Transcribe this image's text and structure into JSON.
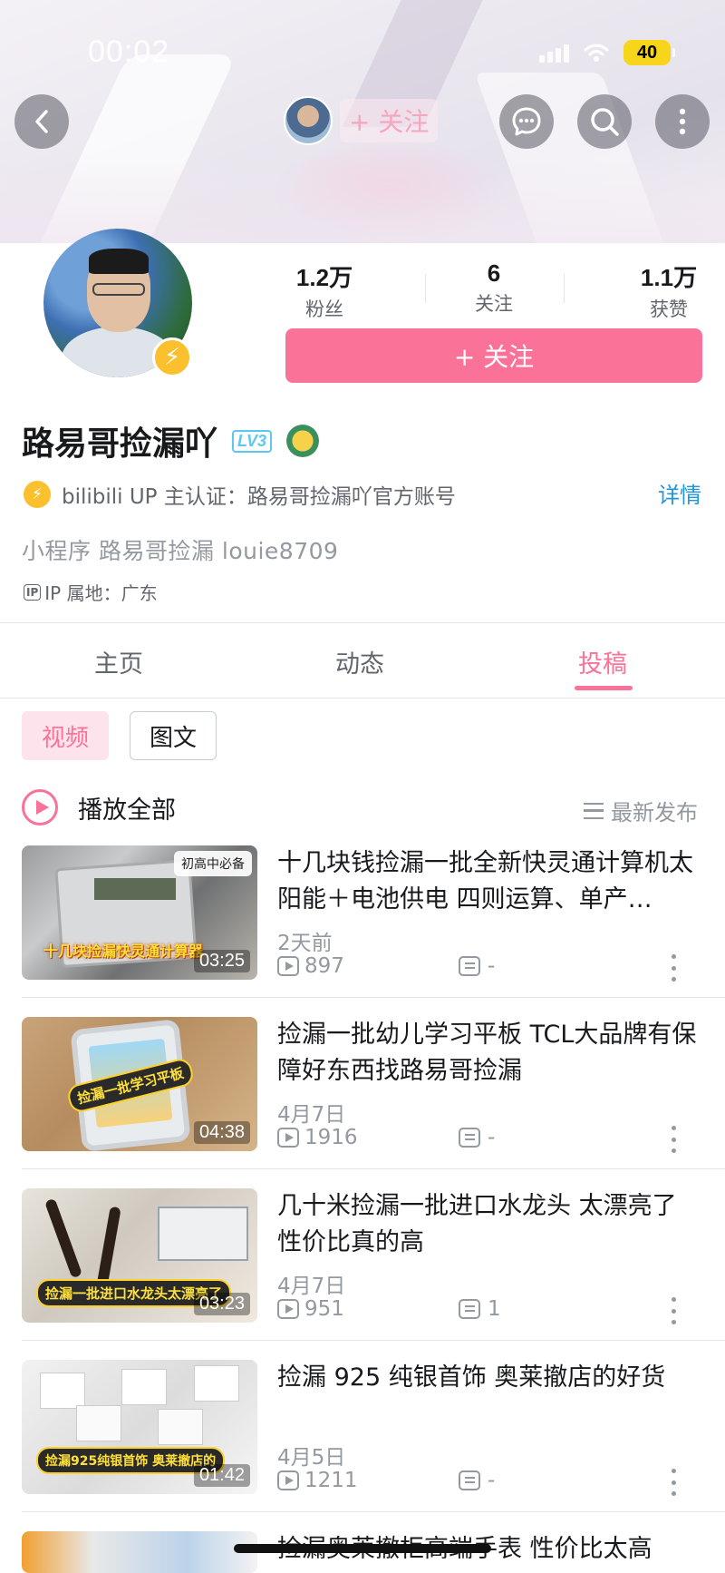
{
  "status_bar": {
    "time": "00:02",
    "battery": "40"
  },
  "header": {
    "follow_label": "+ 关注"
  },
  "profile": {
    "stats": [
      {
        "value": "1.2万",
        "label": "粉丝"
      },
      {
        "value": "6",
        "label": "关注"
      },
      {
        "value": "1.1万",
        "label": "获赞"
      }
    ],
    "follow_button": "+ 关注",
    "name": "路易哥捡漏吖",
    "level": "LV3",
    "certification": "bilibili UP 主认证：路易哥捡漏吖官方账号",
    "detail_link": "详情",
    "bio": "小程序 路易哥捡漏   louie8709",
    "ip_badge": "IP",
    "ip_location": "IP 属地：广东"
  },
  "tabs": [
    {
      "label": "主页",
      "active": false
    },
    {
      "label": "动态",
      "active": false
    },
    {
      "label": "投稿",
      "active": true
    }
  ],
  "filters": {
    "video": "视频",
    "image_text": "图文"
  },
  "playlist": {
    "play_all": "播放全部",
    "sort": "最新发布"
  },
  "videos": [
    {
      "title": "十几块钱捡漏一批全新快灵通计算机太阳能＋电池供电 四则运算、单产…",
      "date": "2天前",
      "views": "897",
      "danmaku": "-",
      "duration": "03:25",
      "thumb_caption": "十几块捡漏快灵通计算器",
      "thumb_corner": "初高中必备"
    },
    {
      "title": "捡漏一批幼儿学习平板 TCL大品牌有保障好东西找路易哥捡漏",
      "date": "4月7日",
      "views": "1916",
      "danmaku": "-",
      "duration": "04:38",
      "thumb_caption": "捡漏一批学习平板"
    },
    {
      "title": "几十米捡漏一批进口水龙头 太漂亮了 性价比真的高",
      "date": "4月7日",
      "views": "951",
      "danmaku": "1",
      "duration": "03:23",
      "thumb_caption": "捡漏一批进口水龙头太漂亮了"
    },
    {
      "title": "捡漏 925 纯银首饰 奥莱撤店的好货",
      "date": "4月5日",
      "views": "1211",
      "danmaku": "-",
      "duration": "01:42",
      "thumb_caption": "捡漏925纯银首饰 奥莱撤店的"
    },
    {
      "title": "捡漏奥莱撤柜高端手表 性价比太高"
    }
  ],
  "colors": {
    "accent": "#fb7299",
    "link": "#2096d9",
    "badge": "#fbc02d"
  }
}
